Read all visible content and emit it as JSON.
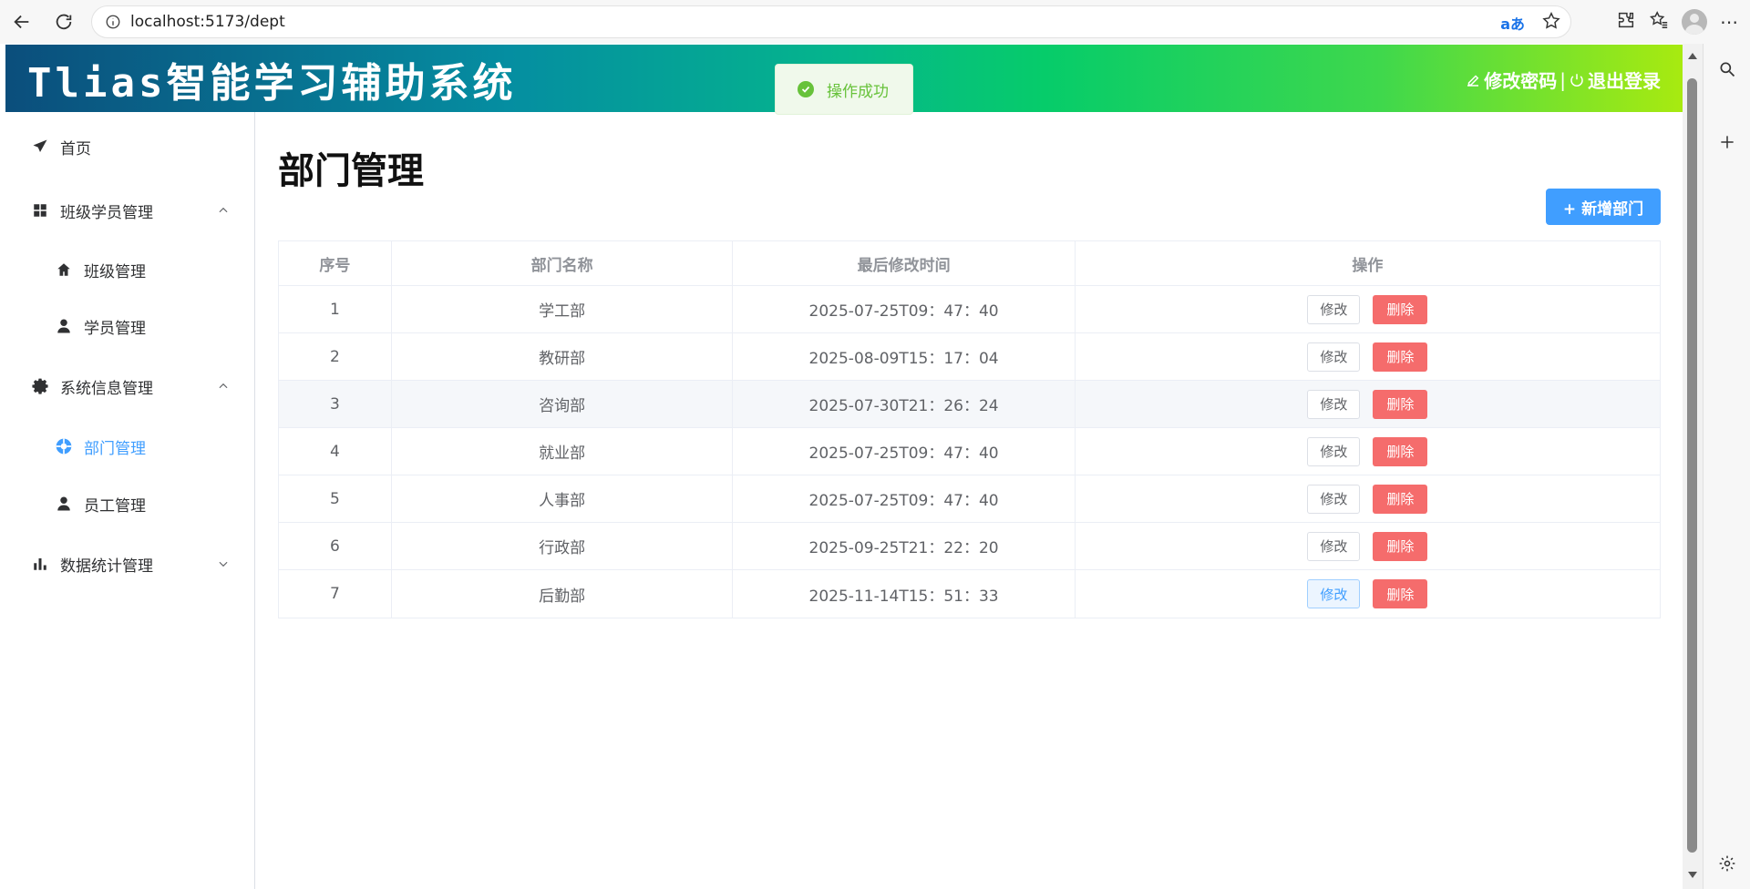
{
  "browser": {
    "url": "localhost:5173/dept"
  },
  "header": {
    "title": "Tlias智能学习辅助系统",
    "change_password": "修改密码",
    "separator": "|",
    "logout": "退出登录"
  },
  "toast": {
    "message": "操作成功"
  },
  "sidebar": {
    "home": "首页",
    "class_student_mgmt": "班级学员管理",
    "class_mgmt": "班级管理",
    "student_mgmt": "学员管理",
    "system_info_mgmt": "系统信息管理",
    "dept_mgmt": "部门管理",
    "employee_mgmt": "员工管理",
    "data_stats_mgmt": "数据统计管理"
  },
  "main": {
    "page_title": "部门管理",
    "add_button": "+ 新增部门",
    "table": {
      "headers": [
        "序号",
        "部门名称",
        "最后修改时间",
        "操作"
      ],
      "edit_label": "修改",
      "delete_label": "删除",
      "rows": [
        {
          "index": "1",
          "name": "学工部",
          "updated": "2025-07-25T09：47：40"
        },
        {
          "index": "2",
          "name": "教研部",
          "updated": "2025-08-09T15：17：04"
        },
        {
          "index": "3",
          "name": "咨询部",
          "updated": "2025-07-30T21：26：24"
        },
        {
          "index": "4",
          "name": "就业部",
          "updated": "2025-07-25T09：47：40"
        },
        {
          "index": "5",
          "name": "人事部",
          "updated": "2025-07-25T09：47：40"
        },
        {
          "index": "6",
          "name": "行政部",
          "updated": "2025-09-25T21：22：20"
        },
        {
          "index": "7",
          "name": "后勤部",
          "updated": "2025-11-14T15：51：33"
        }
      ]
    }
  },
  "colors": {
    "primary": "#409eff",
    "danger": "#f56c6c",
    "success": "#67c23a"
  }
}
